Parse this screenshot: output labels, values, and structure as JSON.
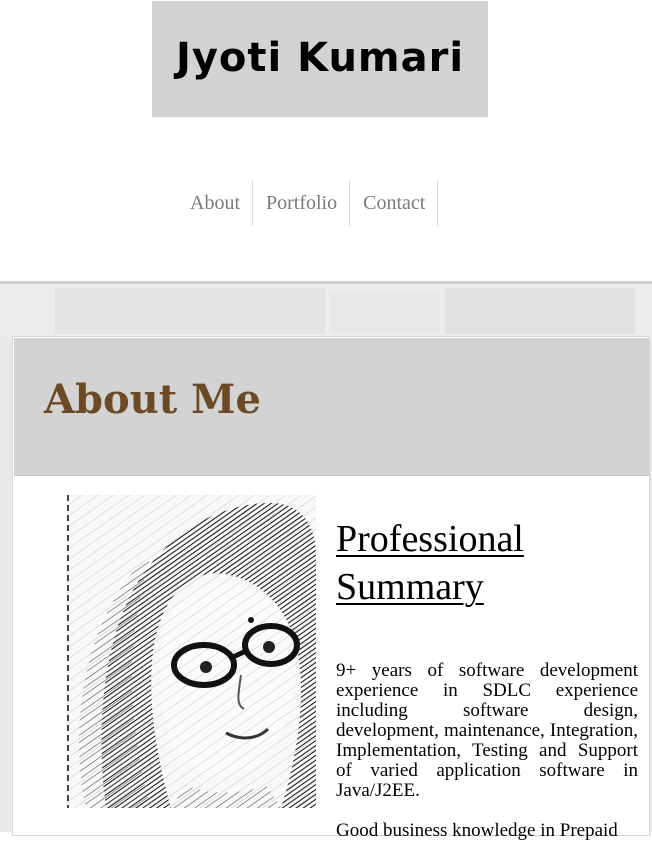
{
  "header": {
    "site_title": "Jyoti Kumari"
  },
  "nav": {
    "items": [
      {
        "label": "About"
      },
      {
        "label": "Portfolio"
      },
      {
        "label": "Contact"
      }
    ]
  },
  "about": {
    "heading": "About Me",
    "photo_alt": "Portrait sketch of Jyoti Kumari",
    "summary_title": "Professional Summary",
    "summary_paragraph_1": "9+ years of software development experience in SDLC experience including software design, development, maintenance, Integration, Implementation, Testing and Support of varied application software in Java/J2EE.",
    "summary_paragraph_2": "Good business knowledge in Prepaid"
  },
  "colors": {
    "title_box_bg": "#d3d3d3",
    "about_heading": "#6b4a25",
    "nav_text": "#7a7a7a"
  }
}
